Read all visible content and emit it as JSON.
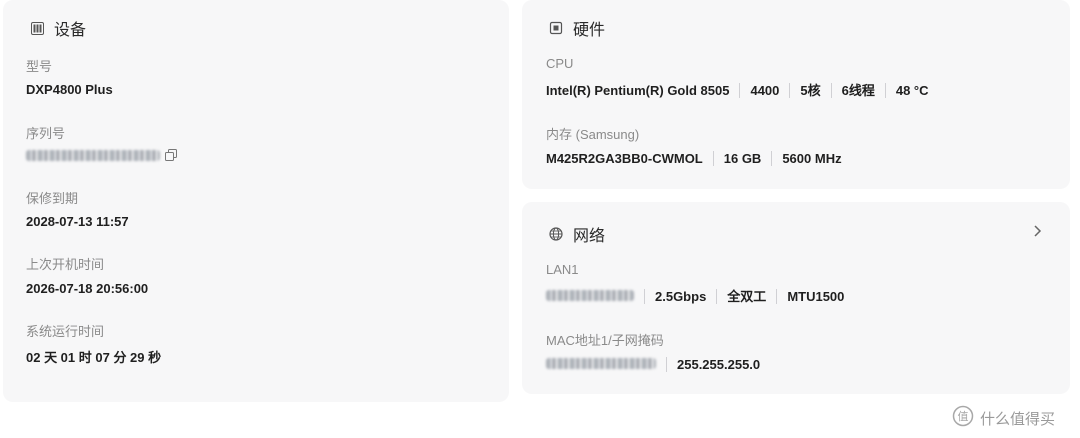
{
  "device": {
    "title": "设备",
    "model_label": "型号",
    "model_value": "DXP4800 Plus",
    "serial_label": "序列号",
    "warranty_label": "保修到期",
    "warranty_value": "2028-07-13 11:57",
    "last_boot_label": "上次开机时间",
    "last_boot_value": "2026-07-18 20:56:00",
    "uptime_label": "系统运行时间",
    "uptime_value": "02 天 01 时 07 分 29 秒"
  },
  "hardware": {
    "title": "硬件",
    "cpu_label": "CPU",
    "cpu_values": [
      "Intel(R) Pentium(R) Gold 8505",
      "4400",
      "5核",
      "6线程",
      "48 °C"
    ],
    "memory_label": "内存 (Samsung)",
    "memory_values": [
      "M425R2GA3BB0-CWMOL",
      "16 GB",
      "5600 MHz"
    ]
  },
  "network": {
    "title": "网络",
    "lan_label": "LAN1",
    "lan_values": [
      "2.5Gbps",
      "全双工",
      "MTU1500"
    ],
    "mac_label": "MAC地址1/子网掩码",
    "mac_values": [
      "255.255.255.0"
    ]
  },
  "watermark": {
    "text": "什么值得买"
  }
}
